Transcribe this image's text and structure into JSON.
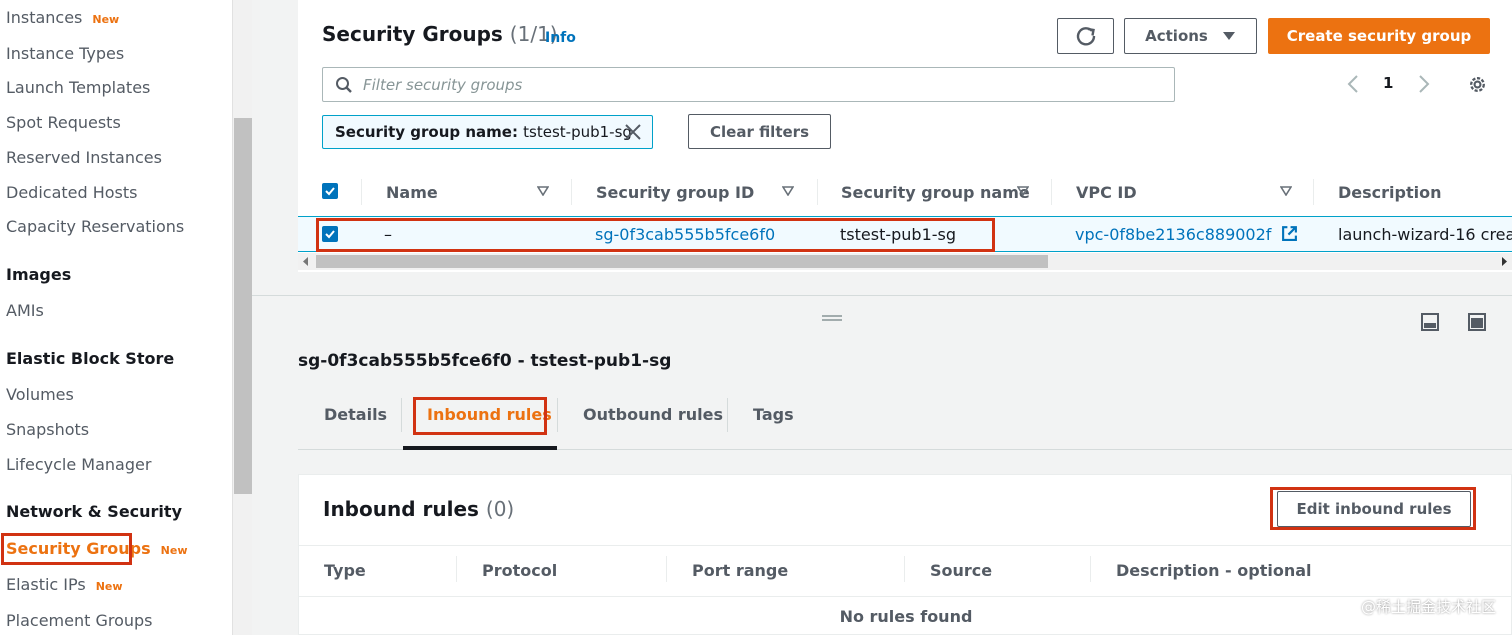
{
  "sidebar": {
    "items": [
      {
        "label": "Instances",
        "badge": "New"
      },
      {
        "label": "Instance Types"
      },
      {
        "label": "Launch Templates"
      },
      {
        "label": "Spot Requests"
      },
      {
        "label": "Reserved Instances"
      },
      {
        "label": "Dedicated Hosts"
      },
      {
        "label": "Capacity Reservations"
      },
      {
        "heading": "Images"
      },
      {
        "label": "AMIs"
      },
      {
        "heading": "Elastic Block Store"
      },
      {
        "label": "Volumes"
      },
      {
        "label": "Snapshots"
      },
      {
        "label": "Lifecycle Manager"
      },
      {
        "heading": "Network & Security"
      },
      {
        "label": "Security Groups",
        "badge": "New"
      },
      {
        "label": "Elastic IPs",
        "badge": "New"
      },
      {
        "label": "Placement Groups"
      }
    ]
  },
  "security_groups": {
    "title": "Security Groups",
    "count": "(1/1)",
    "info": "Info",
    "actions_label": "Actions",
    "create_label": "Create security group",
    "search_placeholder": "Filter security groups",
    "page": "1",
    "filter_chip": {
      "key": "Security group name:",
      "value": "tstest-pub1-sg"
    },
    "clear_filters": "Clear filters",
    "columns": [
      "Name",
      "Security group ID",
      "Security group name",
      "VPC ID",
      "Description"
    ],
    "row": {
      "name": "–",
      "sg_id": "sg-0f3cab555b5fce6f0",
      "sg_name": "tstest-pub1-sg",
      "vpc_id": "vpc-0f8be2136c889002f",
      "description": "launch-wizard-16 crea..."
    }
  },
  "detail": {
    "title": "sg-0f3cab555b5fce6f0 - tstest-pub1-sg",
    "tabs": [
      "Details",
      "Inbound rules",
      "Outbound rules",
      "Tags"
    ]
  },
  "inbound": {
    "title": "Inbound rules",
    "count": "(0)",
    "edit_label": "Edit inbound rules",
    "columns": [
      "Type",
      "Protocol",
      "Port range",
      "Source",
      "Description - optional"
    ],
    "empty": "No rules found"
  },
  "watermark": "@稀土掘金技术社区",
  "colors": {
    "accent": "#ec7211",
    "link": "#0073bb",
    "highlight": "#d13212"
  }
}
